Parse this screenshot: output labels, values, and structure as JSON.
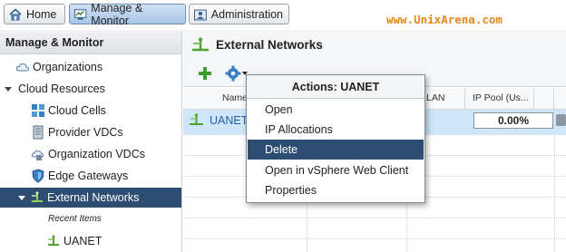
{
  "top_tabs": [
    {
      "label": "Home",
      "icon": "home-icon"
    },
    {
      "label": "Manage & Monitor",
      "icon": "monitor-icon"
    },
    {
      "label": "Administration",
      "icon": "admin-icon"
    }
  ],
  "brand": "www.UnixArena.com",
  "left_panel": {
    "header": "Manage & Monitor",
    "items": [
      {
        "label": "Organizations",
        "icon": "cloud-icon"
      },
      {
        "label": "Cloud Resources",
        "icon": "expand-triangle-icon"
      },
      {
        "label": "Cloud Cells",
        "icon": "cloud-cells-icon"
      },
      {
        "label": "Provider VDCs",
        "icon": "provider-vdc-icon"
      },
      {
        "label": "Organization VDCs",
        "icon": "org-vdc-icon"
      },
      {
        "label": "Edge Gateways",
        "icon": "shield-icon"
      },
      {
        "label": "External Networks",
        "icon": "network-icon"
      },
      {
        "label": "UANET",
        "icon": "network-icon"
      }
    ],
    "recent_label": "Recent Items"
  },
  "right_panel": {
    "title": "External Networks",
    "columns": [
      "Name",
      "LAN",
      "IP Pool (Us..."
    ],
    "rows": [
      {
        "name": "UANET",
        "ip_pool": "0.00%"
      }
    ]
  },
  "actions_menu": {
    "title": "Actions: UANET",
    "items": [
      "Open",
      "IP Allocations",
      "Delete",
      "Open in vSphere Web Client",
      "Properties"
    ],
    "highlighted": "Delete"
  },
  "colors": {
    "selection": "#2e4d73",
    "row_selected": "#cfe6f8",
    "brand": "#e0891a",
    "link": "#1f5fa8"
  }
}
